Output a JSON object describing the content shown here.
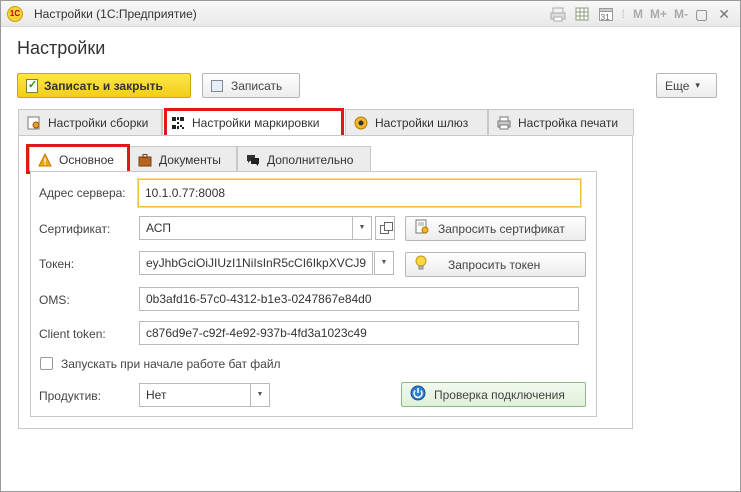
{
  "window": {
    "title": "Настройки  (1С:Предприятие)",
    "logo": "1С",
    "toolbar_icons": [
      "print-icon",
      "spreadsheet-icon",
      "calendar-icon",
      "M",
      "M+",
      "M-",
      "restore-icon",
      "close-icon"
    ],
    "m_labels": [
      "M",
      "M+",
      "M-"
    ],
    "calendar_day": "31"
  },
  "page": {
    "title": "Настройки"
  },
  "toolbar": {
    "save_close_label": "Записать и закрыть",
    "save_label": "Записать",
    "more_label": "Еще",
    "more_arrow": "▾"
  },
  "outer_tabs": [
    {
      "label": "Настройки сборки",
      "icon": "build-settings-icon",
      "active": false
    },
    {
      "label": "Настройки маркировки",
      "icon": "qr-code-icon",
      "active": true,
      "highlighted": true
    },
    {
      "label": "Настройки шлюз",
      "icon": "gateway-icon",
      "active": false
    },
    {
      "label": "Настройка печати",
      "icon": "printer-icon",
      "active": false
    }
  ],
  "inner_tabs": [
    {
      "label": "Основное",
      "icon": "warning-icon",
      "active": true,
      "highlighted": true
    },
    {
      "label": "Документы",
      "icon": "briefcase-icon",
      "active": false
    },
    {
      "label": "Дополнительно",
      "icon": "comments-icon",
      "active": false
    }
  ],
  "form": {
    "server_address": {
      "label": "Адрес сервера:",
      "value": "10.1.0.77:8008"
    },
    "certificate": {
      "label": "Сертификат:",
      "value": "АСП",
      "button": "Запросить сертификат"
    },
    "token": {
      "label": "Токен:",
      "value": "eyJhbGciOiJIUzI1NiIsInR5cCI6IkpXVCJ9",
      "button": "Запросить токен"
    },
    "oms": {
      "label": "OMS:",
      "value": "0b3afd16-57c0-4312-b1e3-0247867e84d0"
    },
    "client_token": {
      "label": "Client token:",
      "value": "c876d9e7-c92f-4e92-937b-4fd3a1023c49"
    },
    "run_bat": {
      "label": "Запускать при начале работе бат файл",
      "checked": false
    },
    "productive": {
      "label": "Продуктив:",
      "value": "Нет"
    },
    "check_connection_button": "Проверка подключения"
  },
  "colors": {
    "highlight": "#e01818",
    "primary_button": "#f4cd17",
    "focus_border": "#f0c040"
  }
}
